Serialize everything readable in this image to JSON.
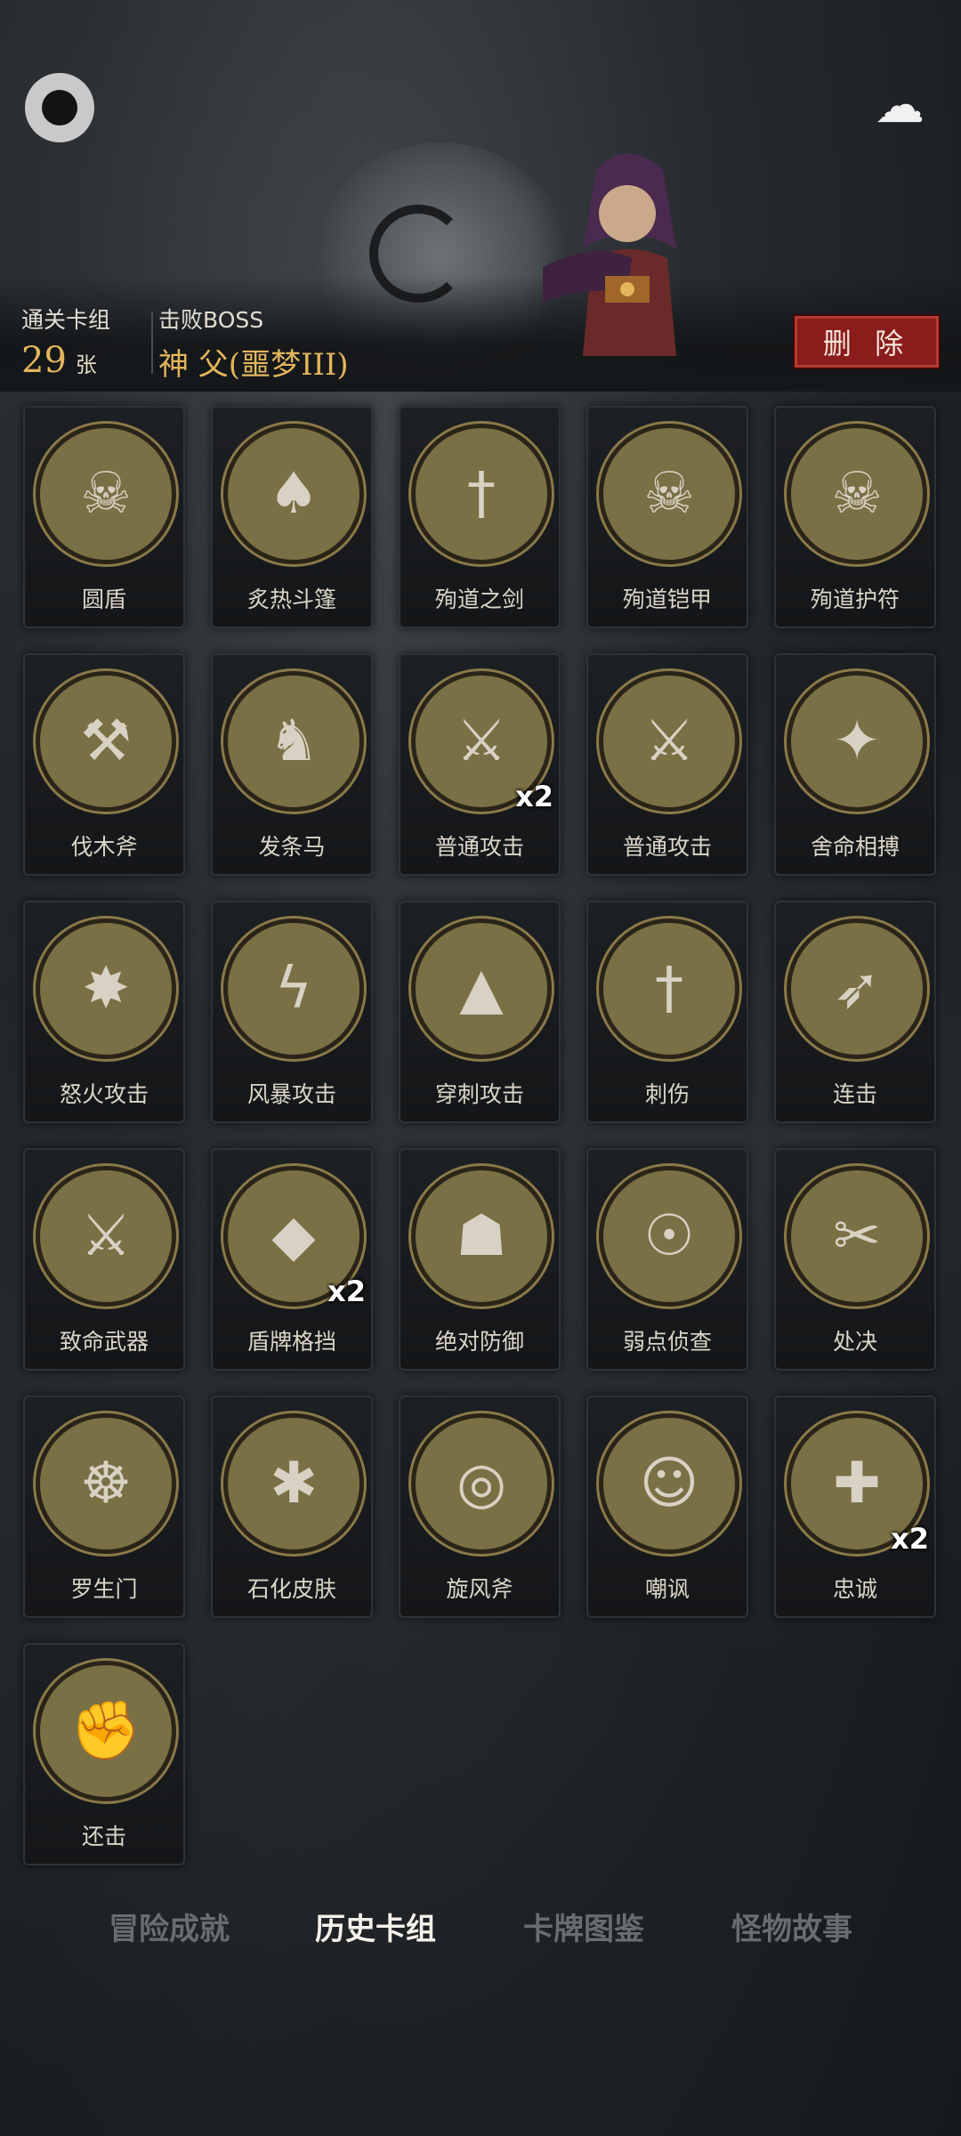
{
  "header": {
    "cleared_deck_label": "通关卡组",
    "card_count": "29",
    "card_unit": "张",
    "defeated_boss_label": "击败BOSS",
    "boss_name": "神 父(噩梦III)",
    "delete_label": "删 除"
  },
  "icons": {
    "menu": "circle-menu-icon",
    "ghost": "ghost-icon"
  },
  "colors": {
    "accent_gold": "#e3b65b",
    "delete_red": "#8b1c1c",
    "card_ring": "#7a7046"
  },
  "cards": [
    {
      "name": "圆盾",
      "glyph": "☠",
      "count": ""
    },
    {
      "name": "炙热斗篷",
      "glyph": "♠",
      "count": ""
    },
    {
      "name": "殉道之剑",
      "glyph": "†",
      "count": ""
    },
    {
      "name": "殉道铠甲",
      "glyph": "☠",
      "count": ""
    },
    {
      "name": "殉道护符",
      "glyph": "☠",
      "count": ""
    },
    {
      "name": "伐木斧",
      "glyph": "⚒",
      "count": ""
    },
    {
      "name": "发条马",
      "glyph": "♞",
      "count": ""
    },
    {
      "name": "普通攻击",
      "glyph": "⚔",
      "count": "x2"
    },
    {
      "name": "普通攻击",
      "glyph": "⚔",
      "count": ""
    },
    {
      "name": "舍命相搏",
      "glyph": "✦",
      "count": ""
    },
    {
      "name": "怒火攻击",
      "glyph": "✸",
      "count": ""
    },
    {
      "name": "风暴攻击",
      "glyph": "ϟ",
      "count": ""
    },
    {
      "name": "穿刺攻击",
      "glyph": "▲",
      "count": ""
    },
    {
      "name": "刺伤",
      "glyph": "†",
      "count": ""
    },
    {
      "name": "连击",
      "glyph": "➶",
      "count": ""
    },
    {
      "name": "致命武器",
      "glyph": "⚔",
      "count": ""
    },
    {
      "name": "盾牌格挡",
      "glyph": "◆",
      "count": "x2"
    },
    {
      "name": "绝对防御",
      "glyph": "☗",
      "count": ""
    },
    {
      "name": "弱点侦查",
      "glyph": "☉",
      "count": ""
    },
    {
      "name": "处决",
      "glyph": "✂",
      "count": ""
    },
    {
      "name": "罗生门",
      "glyph": "☸",
      "count": ""
    },
    {
      "name": "石化皮肤",
      "glyph": "✱",
      "count": ""
    },
    {
      "name": "旋风斧",
      "glyph": "◎",
      "count": ""
    },
    {
      "name": "嘲讽",
      "glyph": "☺",
      "count": ""
    },
    {
      "name": "忠诚",
      "glyph": "✚",
      "count": "x2"
    },
    {
      "name": "还击",
      "glyph": "✊",
      "count": ""
    }
  ],
  "tabs": [
    {
      "label": "冒险成就",
      "active": false
    },
    {
      "label": "历史卡组",
      "active": true
    },
    {
      "label": "卡牌图鉴",
      "active": false
    },
    {
      "label": "怪物故事",
      "active": false
    }
  ]
}
